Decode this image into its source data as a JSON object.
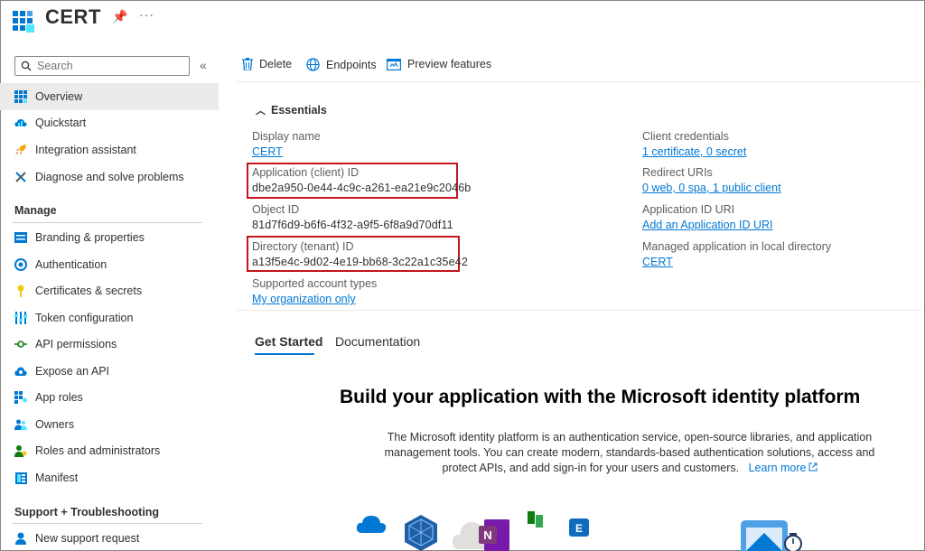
{
  "app": {
    "title": "CERT"
  },
  "search": {
    "placeholder": "Search"
  },
  "sidebar": {
    "top_items": [
      {
        "label": "Overview",
        "icon": "grid-icon"
      },
      {
        "label": "Quickstart",
        "icon": "cloud-icon"
      },
      {
        "label": "Integration assistant",
        "icon": "rocket-icon"
      },
      {
        "label": "Diagnose and solve problems",
        "icon": "wrench-icon"
      }
    ],
    "manage_title": "Manage",
    "manage_items": [
      {
        "label": "Branding & properties",
        "icon": "branding-icon"
      },
      {
        "label": "Authentication",
        "icon": "auth-icon"
      },
      {
        "label": "Certificates & secrets",
        "icon": "key-icon"
      },
      {
        "label": "Token configuration",
        "icon": "token-icon"
      },
      {
        "label": "API permissions",
        "icon": "api-permissions-icon"
      },
      {
        "label": "Expose an API",
        "icon": "cloud-api-icon"
      },
      {
        "label": "App roles",
        "icon": "app-roles-icon"
      },
      {
        "label": "Owners",
        "icon": "owners-icon"
      },
      {
        "label": "Roles and administrators",
        "icon": "roles-icon"
      },
      {
        "label": "Manifest",
        "icon": "manifest-icon"
      }
    ],
    "support_title": "Support + Troubleshooting",
    "support_items": [
      {
        "label": "New support request",
        "icon": "support-icon"
      }
    ]
  },
  "toolbar": {
    "delete": "Delete",
    "endpoints": "Endpoints",
    "preview": "Preview features"
  },
  "essentials": {
    "title": "Essentials",
    "left": [
      {
        "label": "Display name",
        "value": "CERT"
      },
      {
        "label": "Application (client) ID",
        "value": "dbe2a950-0e44-4c9c-a261-ea21e9c2046b"
      },
      {
        "label": "Object ID",
        "value": "81d7f6d9-b6f6-4f32-a9f5-6f8a9d70df11"
      },
      {
        "label": "Directory (tenant) ID",
        "value": "a13f5e4c-9d02-4e19-bb68-3c22a1c35e42"
      },
      {
        "label": "Supported account types",
        "value": "My organization only"
      }
    ],
    "right": [
      {
        "label": "Client credentials",
        "value": "1 certificate, 0 secret"
      },
      {
        "label": "Redirect URIs",
        "value": "0 web, 0 spa, 1 public client"
      },
      {
        "label": "Application ID URI",
        "value": "Add an Application ID URI"
      },
      {
        "label": "Managed application in local directory",
        "value": "CERT"
      }
    ]
  },
  "tabs": [
    {
      "label": "Get Started"
    },
    {
      "label": "Documentation"
    }
  ],
  "hero": {
    "title": "Build your application with the Microsoft identity platform",
    "text": "The Microsoft identity platform is an authentication service, open-source libraries, and application management tools. You can create modern, standards-based authentication solutions, access and protect APIs, and add sign-in for your users and customers.",
    "learn_more": "Learn more"
  },
  "colors": {
    "accent": "#0078d4",
    "highlight": "#c4161c"
  }
}
